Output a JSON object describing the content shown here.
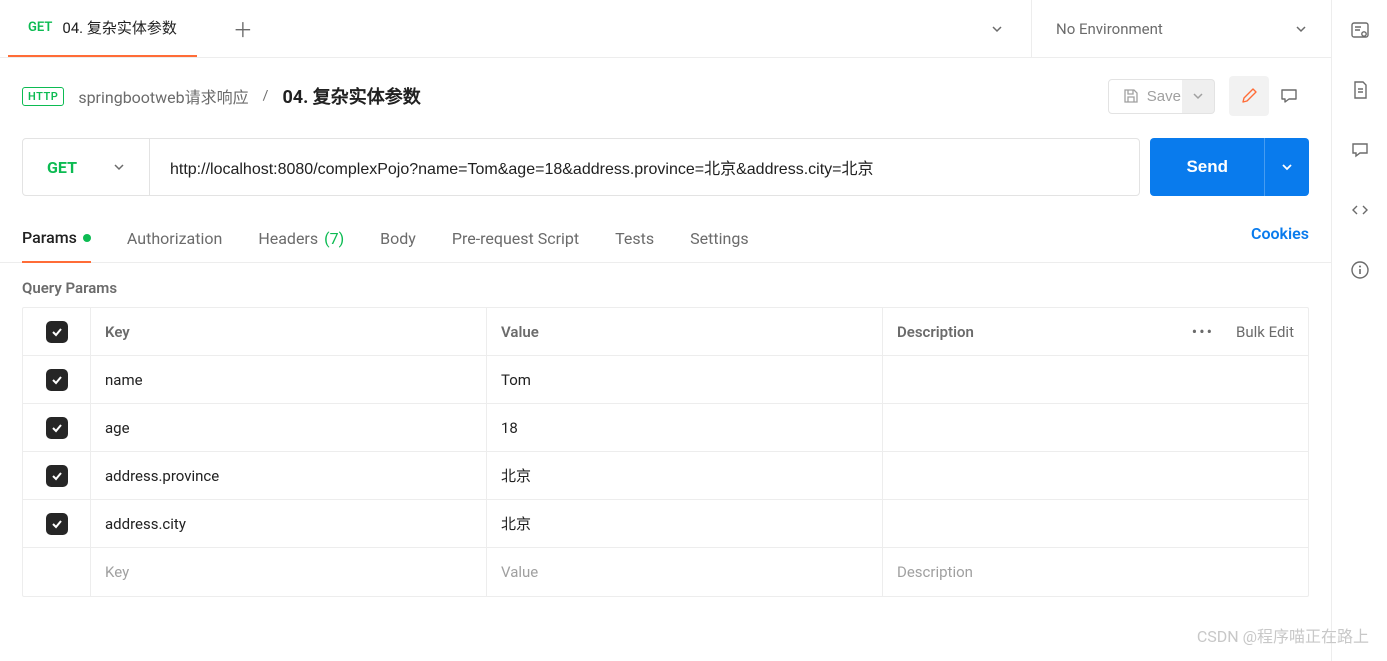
{
  "tab": {
    "method": "GET",
    "title": "04. 复杂实体参数"
  },
  "env": {
    "label": "No Environment"
  },
  "breadcrumb": {
    "badge": "HTTP",
    "parent": "springbootweb请求响应",
    "current": "04. 复杂实体参数"
  },
  "actions": {
    "save": "Save"
  },
  "request": {
    "method": "GET",
    "url": "http://localhost:8080/complexPojo?name=Tom&age=18&address.province=北京&address.city=北京",
    "send": "Send"
  },
  "tabs": {
    "params": "Params",
    "authorization": "Authorization",
    "headers": "Headers",
    "headers_count": "(7)",
    "body": "Body",
    "prerequest": "Pre-request Script",
    "tests": "Tests",
    "settings": "Settings",
    "cookies": "Cookies"
  },
  "section": {
    "title": "Query Params"
  },
  "table": {
    "headers": {
      "key": "Key",
      "value": "Value",
      "description": "Description",
      "bulk": "Bulk Edit",
      "dots": "•••"
    },
    "rows": [
      {
        "key": "name",
        "value": "Tom",
        "description": ""
      },
      {
        "key": "age",
        "value": "18",
        "description": ""
      },
      {
        "key": "address.province",
        "value": "北京",
        "description": ""
      },
      {
        "key": "address.city",
        "value": "北京",
        "description": ""
      }
    ],
    "placeholder": {
      "key": "Key",
      "value": "Value",
      "description": "Description"
    }
  },
  "watermark": "CSDN @程序喵正在路上"
}
